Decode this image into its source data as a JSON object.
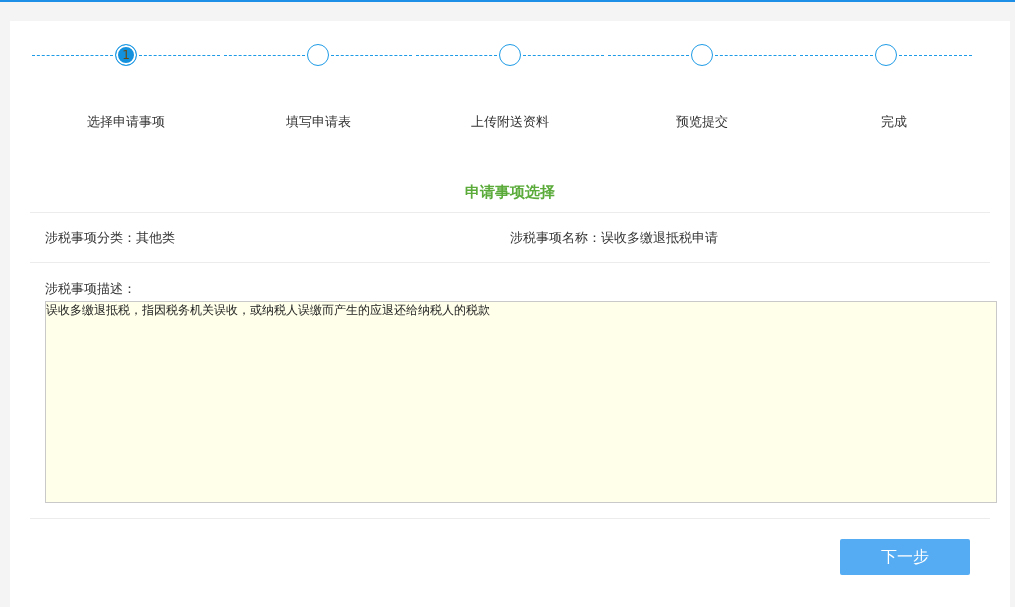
{
  "steps": [
    {
      "label": "选择申请事项",
      "marker": "1",
      "selected": true
    },
    {
      "label": "填写申请表",
      "selected": false
    },
    {
      "label": "上传附送资料",
      "selected": false
    },
    {
      "label": "预览提交",
      "selected": false
    },
    {
      "label": "完成",
      "selected": false
    }
  ],
  "section_title": "申请事项选择",
  "info": [
    {
      "label": "涉税事项分类：",
      "value": "其他类"
    },
    {
      "label": "涉税事项名称：",
      "value": "误收多缴退抵税申请"
    }
  ],
  "description": {
    "label": "涉税事项描述：",
    "value": "误收多缴退抵税，指因税务机关误收，或纳税人误缴而产生的应退还给纳税人的税款"
  },
  "next_button": "下一步"
}
